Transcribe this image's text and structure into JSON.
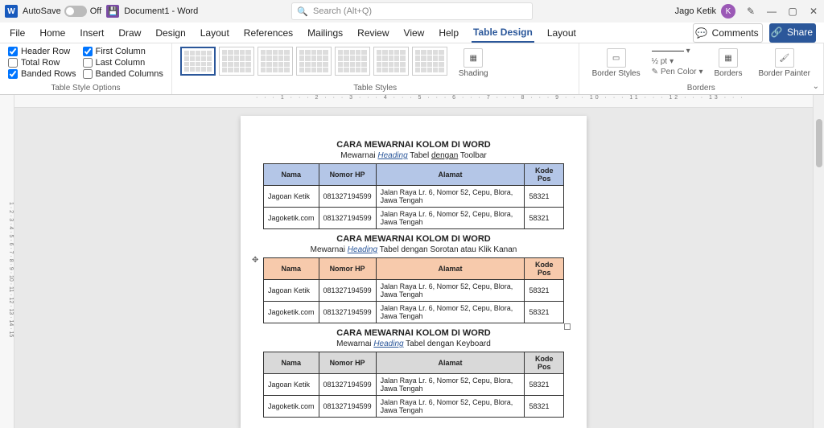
{
  "titlebar": {
    "autosave_label": "AutoSave",
    "autosave_state": "Off",
    "doc_title": "Document1 - Word",
    "search_placeholder": "Search (Alt+Q)",
    "username": "Jago Ketik",
    "avatar_initial": "K"
  },
  "tabs": {
    "items": [
      "File",
      "Home",
      "Insert",
      "Draw",
      "Design",
      "Layout",
      "References",
      "Mailings",
      "Review",
      "View",
      "Help",
      "Table Design",
      "Layout"
    ],
    "active_index": 11,
    "comments": "Comments",
    "share": "Share"
  },
  "ribbon": {
    "style_options": {
      "header_row": "Header Row",
      "total_row": "Total Row",
      "banded_rows": "Banded Rows",
      "first_column": "First Column",
      "last_column": "Last Column",
      "banded_columns": "Banded Columns",
      "label": "Table Style Options"
    },
    "table_styles_label": "Table Styles",
    "shading": "Shading",
    "border_styles": "Border Styles",
    "pen_weight": "½ pt",
    "pen_color": "Pen Color",
    "borders_label": "Borders",
    "borders": "Borders",
    "border_painter": "Border Painter"
  },
  "ruler": "· · · 1 · · · 2 · · · 3 · · · 4 · · · 5 · · · 6 · · · 7 · · · 8 · · · 9 · · · 10 · · · 11 · · · 12 · · · 13 · · ·",
  "vruler": "1 · 2 · 3 · 4 · 5 · 6 · 7 · 8 · 9 · 10 · 11 · 12 · 13 · 14 · 15",
  "doc": {
    "section_title": "CARA MEWARNAI KOLOM DI WORD",
    "sub1_a": "Mewarnai ",
    "sub1_b": "Heading",
    "sub1_c": " Tabel ",
    "sub1_d": "dengan",
    "sub1_e": " Toolbar",
    "sub2_a": "Mewarnai ",
    "sub2_b": "Heading",
    "sub2_c": " Tabel dengan Sorotan atau Klik Kanan",
    "sub3_a": "Mewarnai ",
    "sub3_b": "Heading",
    "sub3_c": " Tabel dengan Keyboard",
    "headers": [
      "Nama",
      "Nomor HP",
      "Alamat",
      "Kode Pos"
    ],
    "rows": [
      {
        "nama": "Jagoan Ketik",
        "hp": "081327194599",
        "alamat_a": "Jalan Raya ",
        "alamat_b": "Lr.",
        "alamat_c": " 6, Nomor 52, Cepu, Blora, Jawa Tengah",
        "pos": "58321"
      },
      {
        "nama": "Jagoketik.com",
        "hp": "081327194599",
        "alamat_a": "Jalan Raya ",
        "alamat_b": "Lr.",
        "alamat_c": " 6, Nomor 52, Cepu, Blora, Jawa Tengah",
        "pos": "58321"
      }
    ]
  }
}
